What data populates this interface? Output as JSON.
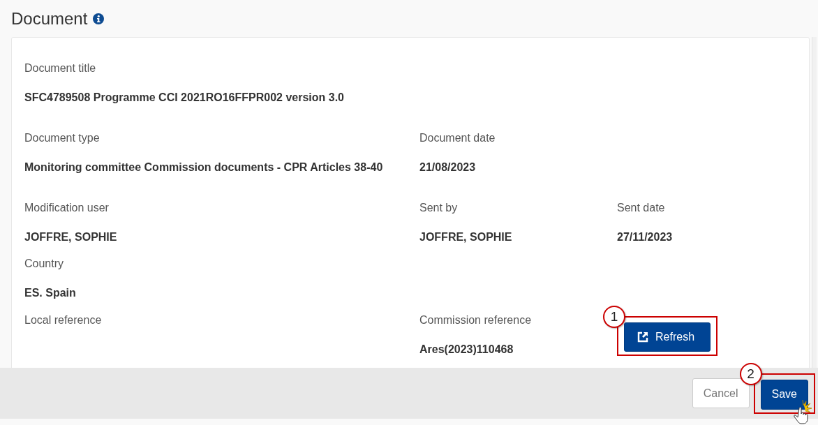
{
  "section": {
    "title": "Document",
    "rows": [
      [
        {
          "kind": "field",
          "label": "Document title",
          "value": "SFC4789508 Programme CCI 2021RO16FFPR002 version 3.0"
        }
      ],
      [
        {
          "kind": "field",
          "label": "Document type",
          "value": "Monitoring committee Commission documents - CPR Articles 38-40"
        },
        {
          "kind": "field",
          "label": "Document date",
          "value": "21/08/2023"
        }
      ],
      [
        {
          "kind": "field",
          "label": "Modification user",
          "value": "JOFFRE, SOPHIE"
        },
        {
          "kind": "field",
          "label": "Sent by",
          "value": "JOFFRE, SOPHIE"
        },
        {
          "kind": "field",
          "label": "Sent date",
          "value": "27/11/2023"
        }
      ],
      [
        {
          "kind": "field",
          "label": "Country",
          "value": "ES. Spain"
        }
      ],
      [
        {
          "kind": "field",
          "label": "Local reference"
        },
        {
          "kind": "field",
          "label": "Commission reference",
          "value": "Ares(2023)110468"
        },
        {
          "kind": "button",
          "label": "Refresh",
          "callout": "1"
        }
      ]
    ]
  },
  "footer": {
    "buttons": [
      {
        "kind": "secondary",
        "label": "Cancel"
      },
      {
        "kind": "primary",
        "label": "Save",
        "callout": "2"
      }
    ]
  }
}
